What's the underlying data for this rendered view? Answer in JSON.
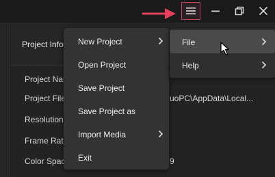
{
  "titlebar": {
    "icons": [
      "hamburger-menu-icon",
      "minimize-icon",
      "maximize-icon",
      "close-icon"
    ],
    "accent_color": "#e8405c"
  },
  "panel": {
    "title": "Project Info",
    "rows": [
      {
        "label": "Project Name",
        "value": ""
      },
      {
        "label": "Project File",
        "value": "uoPC\\AppData\\Local..."
      },
      {
        "label": "Resolution",
        "value": ""
      },
      {
        "label": "Frame Rate",
        "value": ""
      },
      {
        "label": "Color Space",
        "value": "9"
      }
    ]
  },
  "menu": {
    "items": [
      {
        "label": "New Project",
        "has_submenu": true
      },
      {
        "label": "Open Project",
        "has_submenu": false
      },
      {
        "label": "Save Project",
        "has_submenu": false
      },
      {
        "label": "Save Project as",
        "has_submenu": false
      },
      {
        "label": "Import Media",
        "has_submenu": true
      },
      {
        "label": "Exit",
        "has_submenu": false
      }
    ]
  },
  "submenu": {
    "items": [
      {
        "label": "File",
        "has_submenu": true,
        "hovered": true
      },
      {
        "label": "Help",
        "has_submenu": true,
        "hovered": false
      }
    ]
  }
}
